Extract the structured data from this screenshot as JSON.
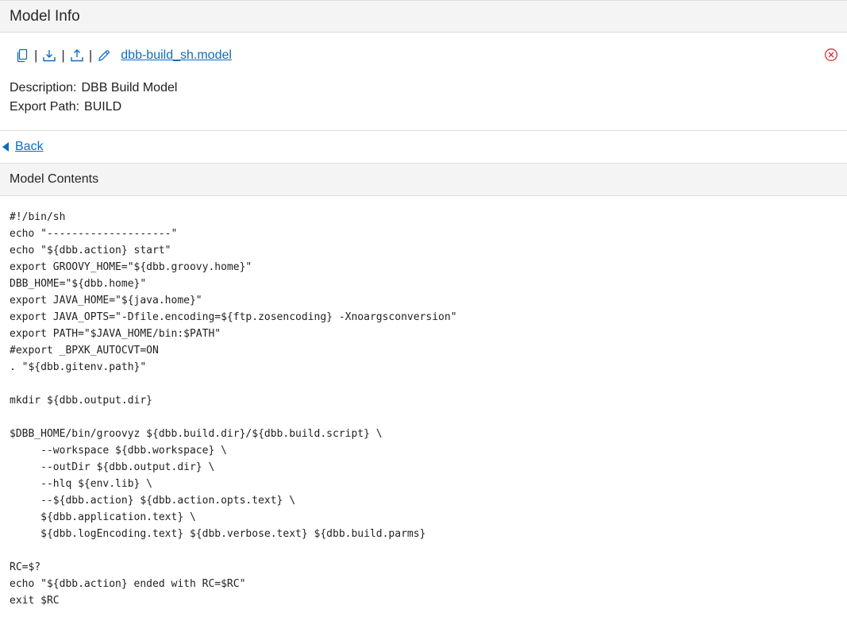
{
  "header": {
    "title": "Model Info"
  },
  "toolbar": {
    "icons": [
      "copy-icon",
      "download-icon",
      "upload-icon",
      "edit-icon"
    ],
    "separator": "|",
    "model_link": "dbb-build_sh.model",
    "close_icon": "close-circle-icon"
  },
  "info": {
    "description_label": "Description:",
    "description_value": "DBB Build Model",
    "export_path_label": "Export Path:",
    "export_path_value": "BUILD"
  },
  "nav": {
    "back_label": "Back"
  },
  "contents": {
    "title": "Model Contents",
    "lines": [
      "#!/bin/sh",
      "echo \"--------------------\"",
      "echo \"${dbb.action} start\"",
      "export GROOVY_HOME=\"${dbb.groovy.home}\"",
      "DBB_HOME=\"${dbb.home}\"",
      "export JAVA_HOME=\"${java.home}\"",
      "export JAVA_OPTS=\"-Dfile.encoding=${ftp.zosencoding} -Xnoargsconversion\"",
      "export PATH=\"$JAVA_HOME/bin:$PATH\"",
      "#export _BPXK_AUTOCVT=ON",
      ". \"${dbb.gitenv.path}\"",
      "",
      "mkdir ${dbb.output.dir}",
      "",
      "$DBB_HOME/bin/groovyz ${dbb.build.dir}/${dbb.build.script} \\",
      "     --workspace ${dbb.workspace} \\",
      "     --outDir ${dbb.output.dir} \\",
      "     --hlq ${env.lib} \\",
      "     --${dbb.action} ${dbb.action.opts.text} \\",
      "     ${dbb.application.text} \\",
      "     ${dbb.logEncoding.text} ${dbb.verbose.text} ${dbb.build.parms}",
      "",
      "RC=$?",
      "echo \"${dbb.action} ended with RC=$RC\"",
      "exit $RC"
    ]
  },
  "colors": {
    "accent": "#0f6cbd",
    "danger": "#d13438",
    "header_bg": "#f4f4f4"
  }
}
